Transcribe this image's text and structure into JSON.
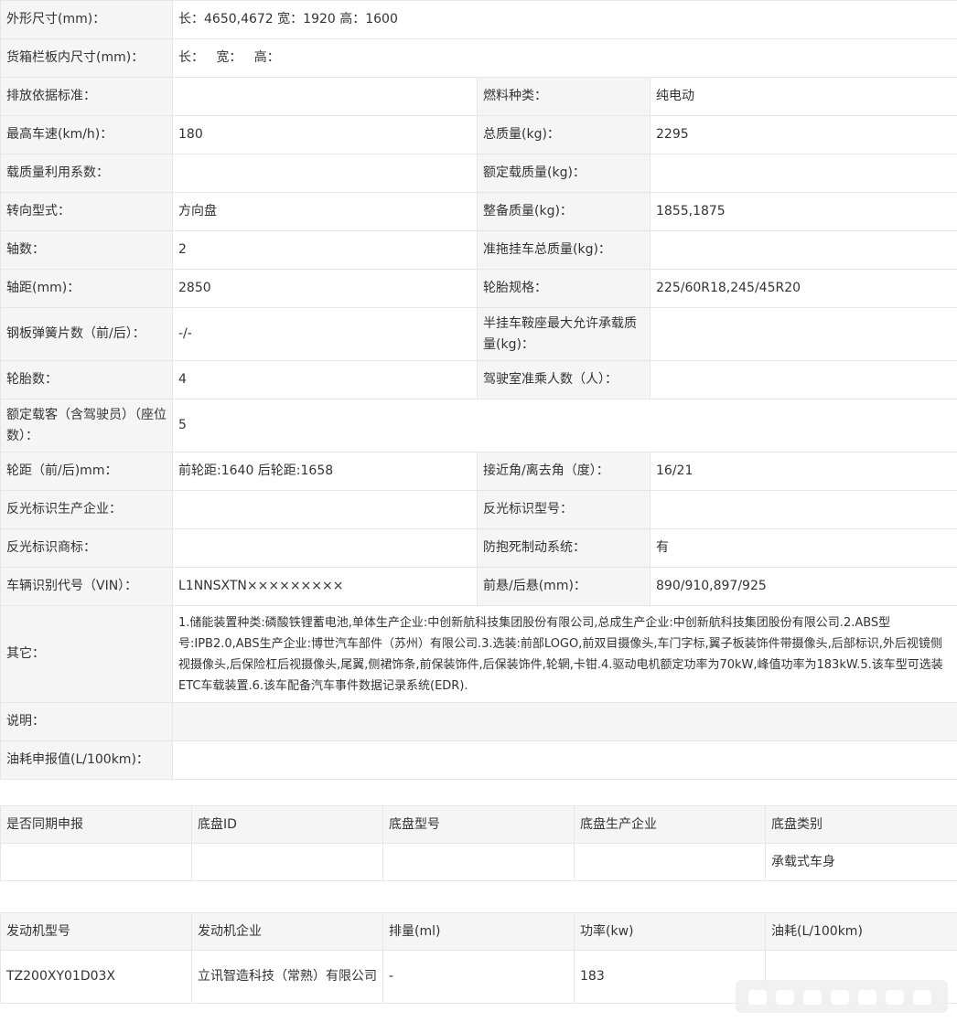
{
  "spec": {
    "dimensions_label": "外形尺寸(mm)：",
    "dimensions_value": "长：4650,4672 宽：1920 高：1600",
    "cargo_label": "货箱栏板内尺寸(mm)：",
    "cargo_value": "长：   宽：   高：",
    "emission_label": "排放依据标准：",
    "emission_value": "",
    "fuel_label": "燃料种类：",
    "fuel_value": "纯电动",
    "speed_label": "最高车速(km/h)：",
    "speed_value": "180",
    "total_mass_label": "总质量(kg)：",
    "total_mass_value": "2295",
    "load_coef_label": "载质量利用系数：",
    "load_coef_value": "",
    "rated_load_label": "额定载质量(kg)：",
    "rated_load_value": "",
    "steering_label": "转向型式：",
    "steering_value": "方向盘",
    "curb_label": "整备质量(kg)：",
    "curb_value": "1855,1875",
    "axles_label": "轴数：",
    "axles_value": "2",
    "trailer_label": "准拖挂车总质量(kg)：",
    "trailer_value": "",
    "wheelbase_label": "轴距(mm)：",
    "wheelbase_value": "2850",
    "tire_spec_label": "轮胎规格：",
    "tire_spec_value": "225/60R18,245/45R20",
    "spring_label": "钢板弹簧片数（前/后）：",
    "spring_value": "-/-",
    "saddle_label": "半挂车鞍座最大允许承载质量(kg)：",
    "saddle_value": "",
    "tires_label": "轮胎数：",
    "tires_value": "4",
    "cab_label": "驾驶室准乘人数（人）：",
    "cab_value": "",
    "passengers_label": "额定载客（含驾驶员）（座位数）：",
    "passengers_value": "5",
    "track_label": "轮距（前/后)mm：",
    "track_value": "前轮距:1640 后轮距:1658",
    "angle_label": "接近角/离去角（度）：",
    "angle_value": "16/21",
    "reflect_maker_label": "反光标识生产企业：",
    "reflect_maker_value": "",
    "reflect_model_label": "反光标识型号：",
    "reflect_model_value": "",
    "reflect_brand_label": "反光标识商标：",
    "reflect_brand_value": "",
    "abs_label": "防抱死制动系统：",
    "abs_value": "有",
    "vin_label": "车辆识别代号（VIN）：",
    "vin_value": "L1NNSXTN×××××××××",
    "overhang_label": "前悬/后悬(mm)：",
    "overhang_value": "890/910,897/925",
    "other_label": "其它：",
    "other_value": "1.储能装置种类:磷酸铁锂蓄电池,单体生产企业:中创新航科技集团股份有限公司,总成生产企业:中创新航科技集团股份有限公司.2.ABS型号:IPB2.0,ABS生产企业:博世汽车部件（苏州）有限公司.3.选装:前部LOGO,前双目摄像头,车门字标,翼子板装饰件带摄像头,后部标识,外后视镜侧视摄像头,后保险杠后视摄像头,尾翼,侧裙饰条,前保装饰件,后保装饰件,轮辋,卡钳.4.驱动电机额定功率为70kW,峰值功率为183kW.5.该车型可选装ETC车载装置.6.该车配备汽车事件数据记录系统(EDR).",
    "note_label": "说明：",
    "note_value": "",
    "fuel_consumption_label": "油耗申报值(L/100km)：",
    "fuel_consumption_value": ""
  },
  "chassis": {
    "headers": [
      "是否同期申报",
      "底盘ID",
      "底盘型号",
      "底盘生产企业",
      "底盘类别"
    ],
    "row": [
      "",
      "",
      "",
      "",
      "承载式车身"
    ]
  },
  "engine": {
    "headers": [
      "发动机型号",
      "发动机企业",
      "排量(ml)",
      "功率(kw)",
      "油耗(L/100km)"
    ],
    "row": [
      "TZ200XY01D03X",
      "立讯智造科技（常熟）有限公司",
      "-",
      "183",
      ""
    ]
  }
}
